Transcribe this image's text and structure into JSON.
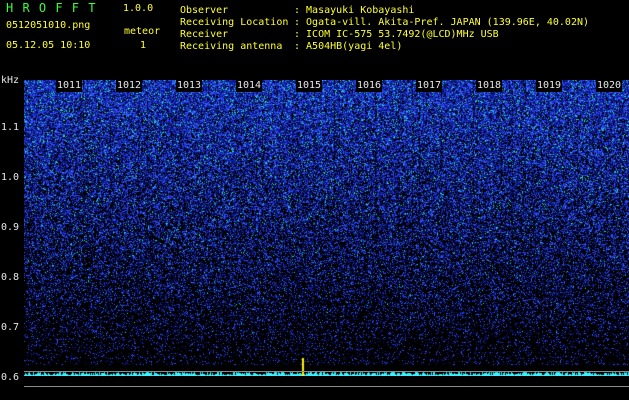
{
  "header": {
    "app_title": "H R O F F T",
    "version": "1.0.0",
    "filename": "0512051010.png",
    "meteor_label": "meteor",
    "meteor_count": "1",
    "datetime": "05.12.05 10:10",
    "fields": [
      {
        "label": "Observer",
        "value": ": Masayuki Kobayashi"
      },
      {
        "label": "Receiving Location",
        "value": ": Ogata-vill. Akita-Pref. JAPAN (139.96E, 40.02N)"
      },
      {
        "label": "Receiver",
        "value": ": ICOM IC-575 53.7492(@LCD)MHz USB"
      },
      {
        "label": "Receiving antenna",
        "value": ": A504HB(yagi 4el)"
      }
    ]
  },
  "spectrogram": {
    "unit_label": "kHz",
    "freq_ticks": [
      "1.1",
      "1.0",
      "0.9",
      "0.8",
      "0.7",
      "0.6"
    ],
    "time_ticks": [
      "1011",
      "1012",
      "1013",
      "1014",
      "1015",
      "1016",
      "1017",
      "1018",
      "1019",
      "1020"
    ],
    "freq_range": [
      0.58,
      1.2
    ],
    "colors": {
      "background": "#000000",
      "noise_dark": "#0a1890",
      "noise_mid": "#2d4bff",
      "noise_hot": "#1ed2c8",
      "trace": "#3cf0ff",
      "meteor": "#ffee00"
    }
  }
}
